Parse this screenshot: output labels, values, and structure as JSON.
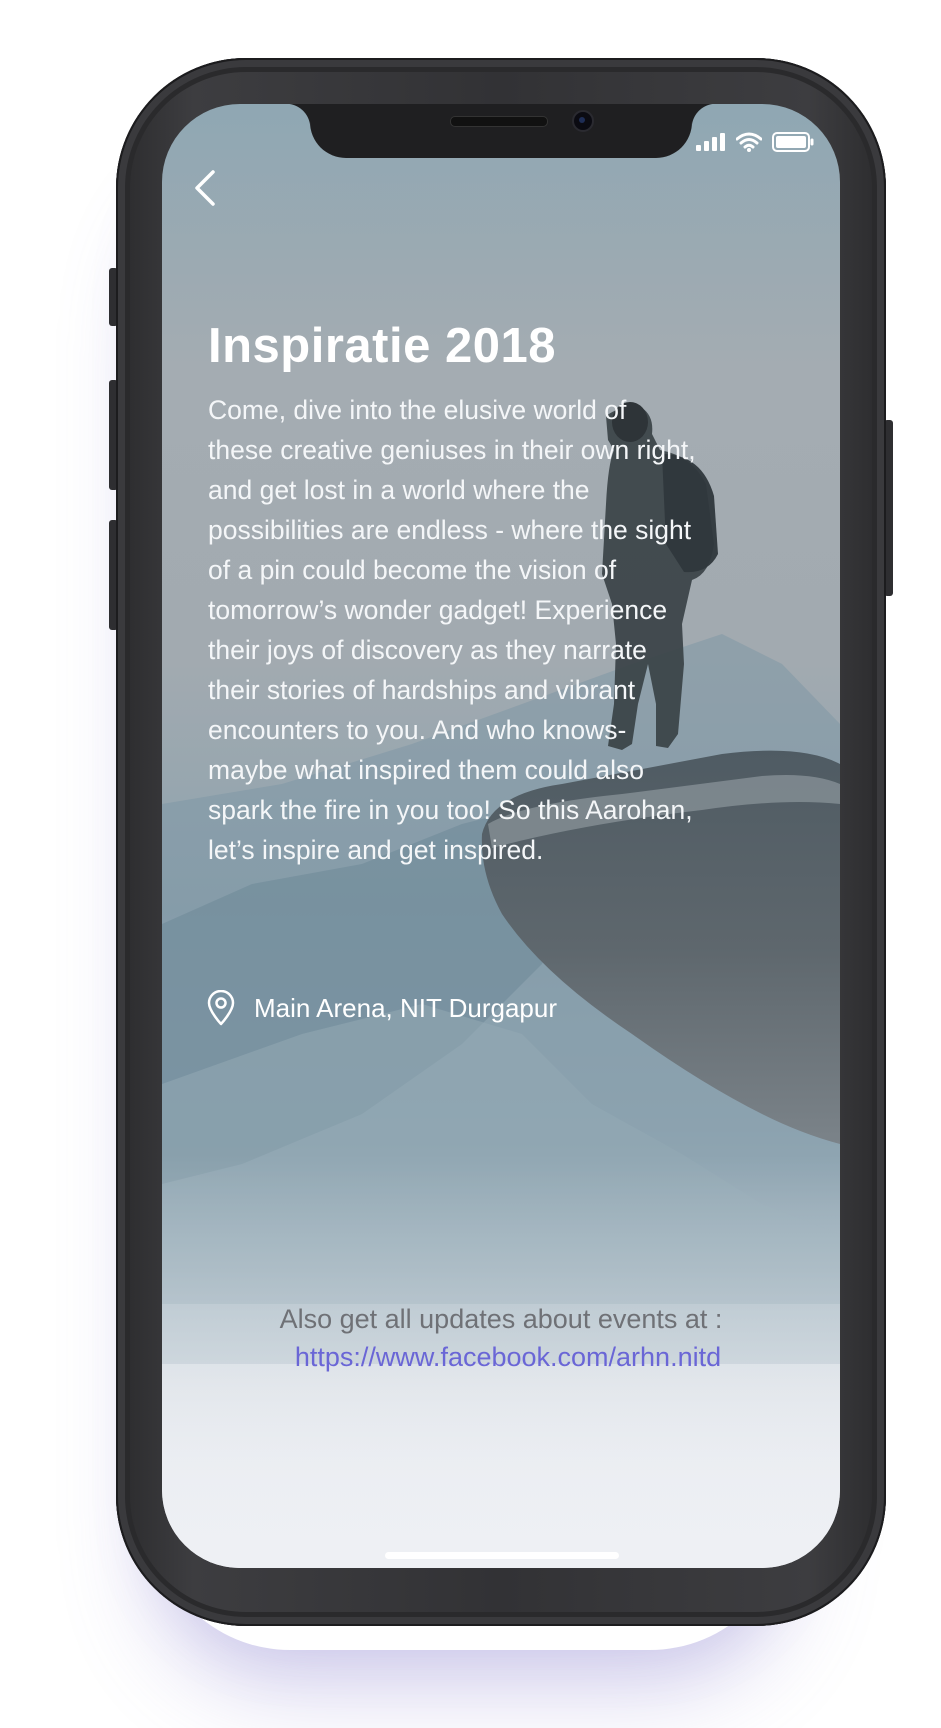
{
  "event": {
    "title": "Inspiratie 2018",
    "description": "Come, dive into the elusive world of\nthese creative geniuses in their own right,\nand get lost in a world where the\npossibilities are endless - where the sight\nof a pin could become the vision of\ntomorrow’s wonder gadget! Experience\ntheir joys of discovery as they narrate\ntheir stories of hardships and vibrant\nencounters to you. And who knows-\nmaybe what inspired them could also\nspark the fire in you too! So this Aarohan,\nlet’s inspire and get inspired.",
    "location": "Main Arena, NIT Durgapur",
    "location_icon": "map-pin-icon"
  },
  "nav": {
    "back_icon": "chevron-left-icon"
  },
  "status_bar": {
    "icons": [
      "signal-icon",
      "wifi-icon",
      "battery-icon"
    ]
  },
  "footer": {
    "updates_text": "Also get all updates about events at :",
    "link_text": "https://www.facebook.com/arhn.nitd"
  },
  "colors": {
    "title_text": "#ffffff",
    "link": "#6a66d6",
    "footer_text": "#6f7176",
    "phone_body": "#333336"
  }
}
